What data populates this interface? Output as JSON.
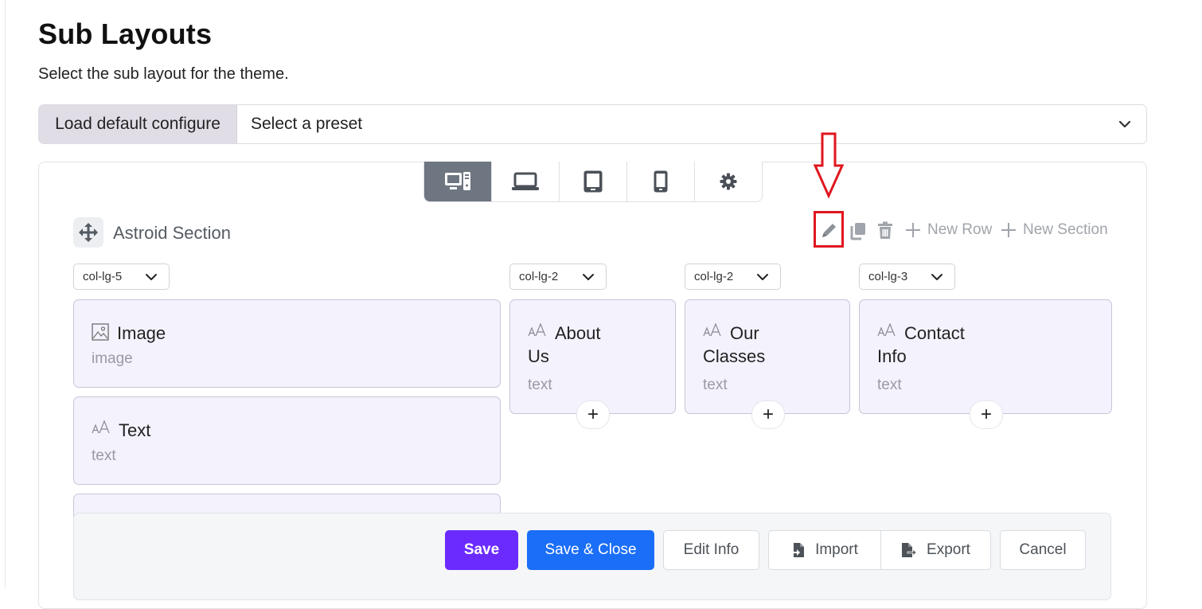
{
  "page": {
    "title": "Sub Layouts",
    "subtitle": "Select the sub layout for the theme."
  },
  "preset": {
    "addon_label": "Load default configure",
    "selected": "Select a preset"
  },
  "devices": [
    {
      "icon": "desktop-icon",
      "active": true
    },
    {
      "icon": "laptop-icon",
      "active": false
    },
    {
      "icon": "tablet-icon",
      "active": false
    },
    {
      "icon": "mobile-icon",
      "active": false
    },
    {
      "icon": "gear-icon",
      "active": false
    }
  ],
  "section": {
    "name": "Astroid Section",
    "tools": {
      "edit_icon": "pencil-icon",
      "copy_icon": "copy-icon",
      "delete_icon": "trash-icon",
      "new_row": "New Row",
      "new_section": "New Section"
    }
  },
  "columns": [
    {
      "size": "col-lg-5",
      "elements": [
        {
          "title": "Image",
          "type": "image",
          "icon": "image-icon"
        },
        {
          "title": "Text",
          "type": "text",
          "icon": "text-size-icon"
        }
      ]
    },
    {
      "size": "col-lg-2",
      "elements": [
        {
          "title_line1": "About",
          "title_line2": "Us",
          "type": "text",
          "icon": "text-size-icon"
        }
      ]
    },
    {
      "size": "col-lg-2",
      "elements": [
        {
          "title_line1": "Our",
          "title_line2": "Classes",
          "type": "text",
          "icon": "text-size-icon"
        }
      ]
    },
    {
      "size": "col-lg-3",
      "elements": [
        {
          "title_line1": "Contact",
          "title_line2": "Info",
          "type": "text",
          "icon": "text-size-icon"
        }
      ]
    }
  ],
  "plus_label": "+",
  "footer": {
    "save": "Save",
    "save_close": "Save & Close",
    "edit_info": "Edit Info",
    "import": "Import",
    "export": "Export",
    "cancel": "Cancel"
  },
  "colors": {
    "primary_purple": "#6b2bff",
    "primary_blue": "#1a6ef7",
    "highlight_red": "#e0161e",
    "card_bg": "#f4f2fd"
  }
}
